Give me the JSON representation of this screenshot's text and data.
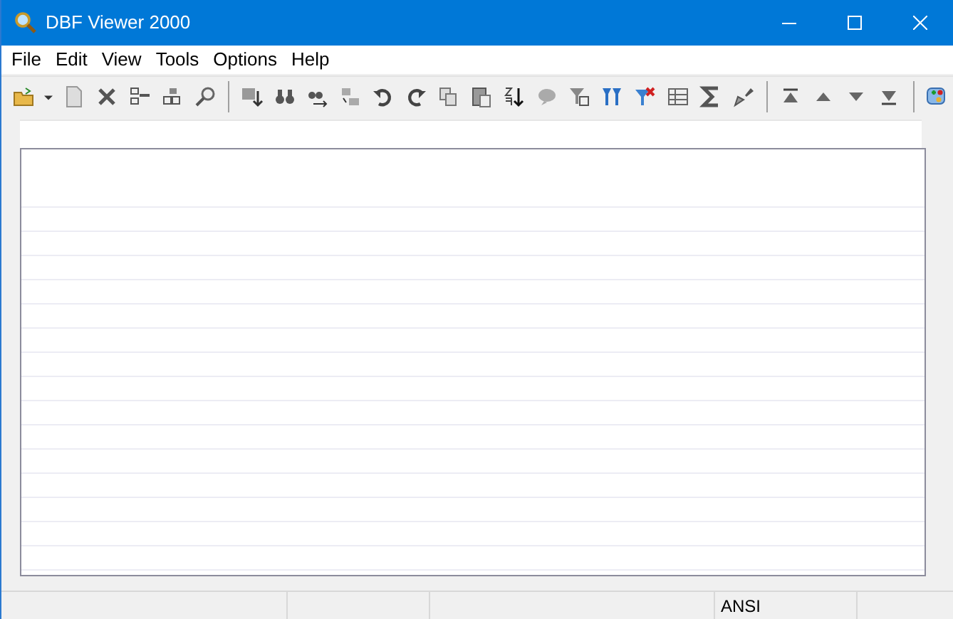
{
  "window": {
    "title": "DBF Viewer 2000"
  },
  "menu": [
    {
      "label": "File"
    },
    {
      "label": "Edit"
    },
    {
      "label": "View"
    },
    {
      "label": "Tools"
    },
    {
      "label": "Options"
    },
    {
      "label": "Help"
    }
  ],
  "status_bar": {
    "encoding": "ANSI"
  }
}
